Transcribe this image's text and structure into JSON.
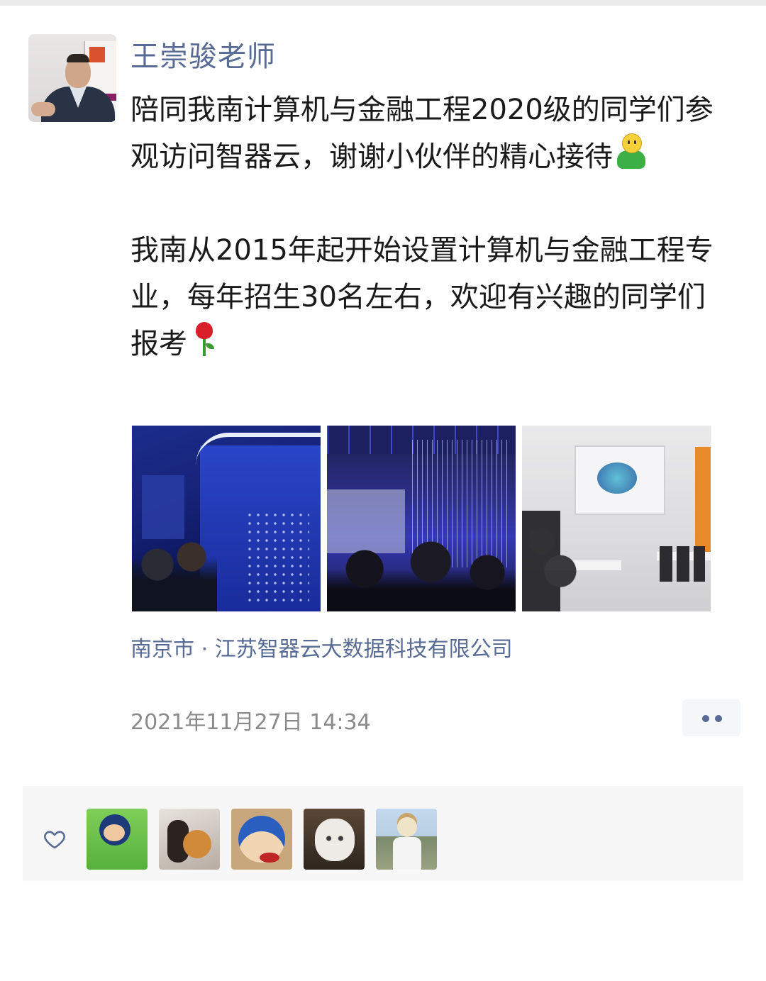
{
  "post": {
    "author": "王崇骏老师",
    "paragraph1": "陪同我南计算机与金融工程2020级的同学们参观访问智器云，谢谢小伙伴的精心接待",
    "paragraph2": "我南从2015年起开始设置计算机与金融工程专业，每年招生30名左右，欢迎有兴趣的同学们报考",
    "emoji1": "person-emoji",
    "emoji2": "rose-emoji",
    "photos": [
      {
        "alt": "photo-exhibition-blue-wall"
      },
      {
        "alt": "photo-light-installation"
      },
      {
        "alt": "photo-meeting-room"
      }
    ],
    "location": "南京市 · 江苏智器云大数据科技有限公司",
    "timestamp": "2021年11月27日 14:34"
  },
  "likes": {
    "icon": "heart-icon",
    "count_avatars": 5
  },
  "colors": {
    "name_link": "#576b95",
    "text": "#1a1a1a",
    "meta": "#8a8a8a",
    "likes_bg": "#f7f7f7"
  }
}
